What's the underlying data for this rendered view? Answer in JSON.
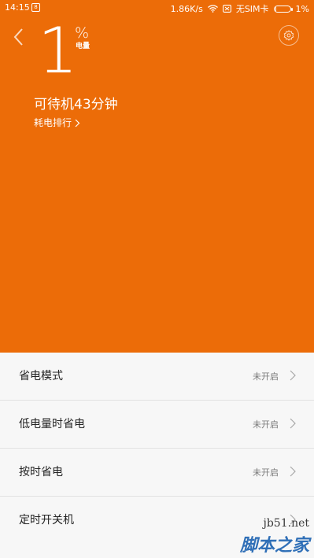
{
  "status_bar": {
    "time": "14:15",
    "notification_glyph": "8",
    "net_speed": "1.86K/s",
    "sim_status": "无SIM卡",
    "battery_percent": "1%",
    "battery_level": 0.01
  },
  "header": {
    "battery_value": "1",
    "percent_sign": "%",
    "battery_label": "电量",
    "standby_text": "可待机43分钟",
    "ranking_link": "耗电排行"
  },
  "icons": {
    "back": "chevron-left-icon",
    "settings": "gear-icon",
    "item_chevron": "chevron-right-icon"
  },
  "colors": {
    "accent": "#ec6c08",
    "list_background": "#f7f7f7"
  },
  "list": {
    "items": [
      {
        "label": "省电模式",
        "status": "未开启"
      },
      {
        "label": "低电量时省电",
        "status": "未开启"
      },
      {
        "label": "按时省电",
        "status": "未开启"
      },
      {
        "label": "定时开关机",
        "status": ""
      }
    ]
  },
  "watermark": {
    "site": "jb51.net",
    "name": "脚本之家"
  }
}
